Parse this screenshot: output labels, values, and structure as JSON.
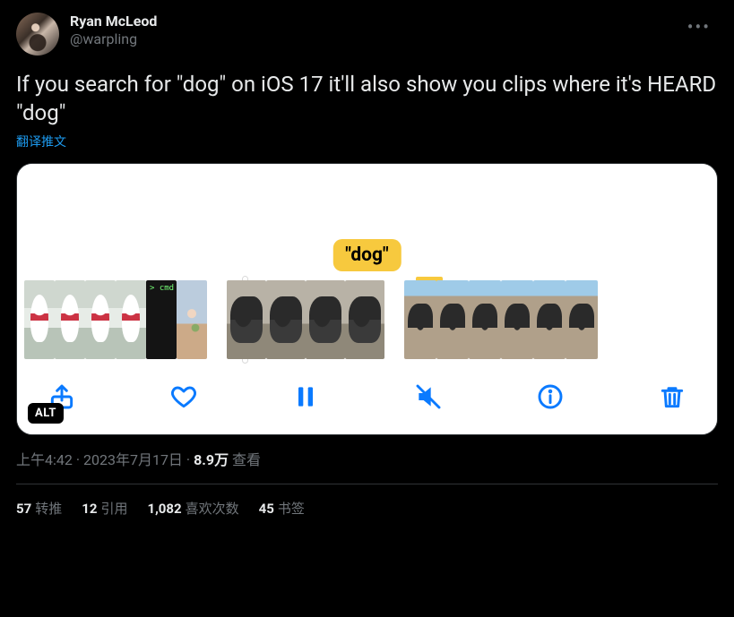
{
  "author": {
    "name": "Ryan McLeod",
    "handle": "@warpling"
  },
  "tweet_text": "If you search for \"dog\" on iOS 17 it'll also show you clips where it's HEARD \"dog\"",
  "translate_label": "翻译推文",
  "chip_label": "\"dog\"",
  "alt_badge": "ALT",
  "meta": {
    "time": "上午4:42",
    "sep1": " · ",
    "date": "2023年7月17日",
    "sep2": " · ",
    "views_count": "8.9万",
    "views_label": " 查看"
  },
  "stats": {
    "retweets_count": "57",
    "retweets_label": "转推",
    "quotes_count": "12",
    "quotes_label": "引用",
    "likes_count": "1,082",
    "likes_label": "喜欢次数",
    "bookmarks_count": "45",
    "bookmarks_label": "书签"
  }
}
